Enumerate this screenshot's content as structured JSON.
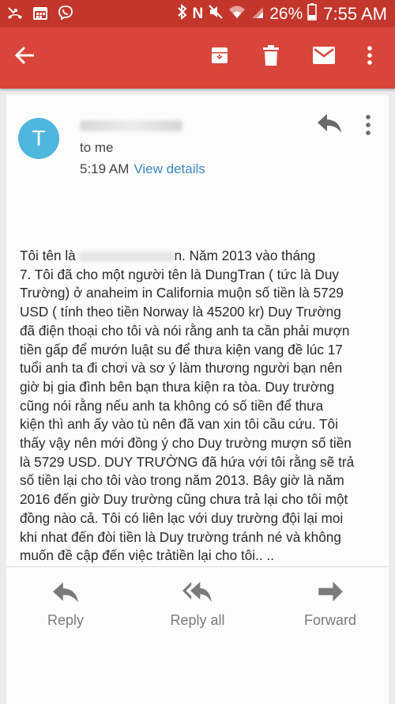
{
  "status_bar": {
    "battery_pct": "26%",
    "time": "7:55 AM",
    "icons": [
      "missed-call-icon",
      "calendar-icon",
      "viber-icon",
      "bluetooth-icon",
      "nfc-icon",
      "mute-icon",
      "wifi-icon",
      "signal-icon",
      "battery-icon"
    ]
  },
  "toolbar": {
    "icons": [
      "back-arrow-icon",
      "archive-icon",
      "trash-icon",
      "mail-icon",
      "more-vert-icon"
    ],
    "accent_color": "#d9453a",
    "status_color": "#c3362b"
  },
  "email": {
    "avatar_letter": "T",
    "avatar_color": "#4fb6dd",
    "to": "to me",
    "time": "5:19 AM",
    "view_details": "View details",
    "body_start": "Tôi tên là ",
    "body_rest": "n.  Năm 2013 vào tháng\n7. Tôi đã cho một người tên là DungTran ( tức là Duy\nTrường) ở anaheim in California muộn số tiền là 5729\nUSD ( tính theo tiền Norway là 45200 kr)  Duy Trường\nđã điện thoại cho tôi và nói rằng anh ta cần phải mượn\ntiền gấp để mướn luật su để thưa kiện vang đề lúc 17\ntuổi anh ta đi chơi và sơ ý làm thương người bạn nên\ngiờ bị gia đình bên bạn thưa kiện ra tòa. Duy trường\ncũng nói rằng nếu anh ta không có số tiền để thưa\nkiện thì anh ấy vào tù nên đã van xin tôi cầu cứu.  Tôi\nthấy vậy nên mới đồng ý cho Duy trường mượn số tiền\nlà 5729 USD. DUY TRƯỜNG đã hứa với tôi rằng sẽ trả\nsố tiền lại cho tôi vào trong năm 2013. Bây giờ là năm\n2016  đến giờ Duy trường cũng chưa trả lại cho tôi một\nđồng nào cả. Tôi có liên lạc với duy trường đội lại moi\nkhi nhat đến đòi tiền là Duy trường tránh né và không\nmuốn đề cập đến việc trảtiền lại cho tôi.. .."
  },
  "actions": {
    "reply": "Reply",
    "reply_all": "Reply all",
    "forward": "Forward"
  }
}
